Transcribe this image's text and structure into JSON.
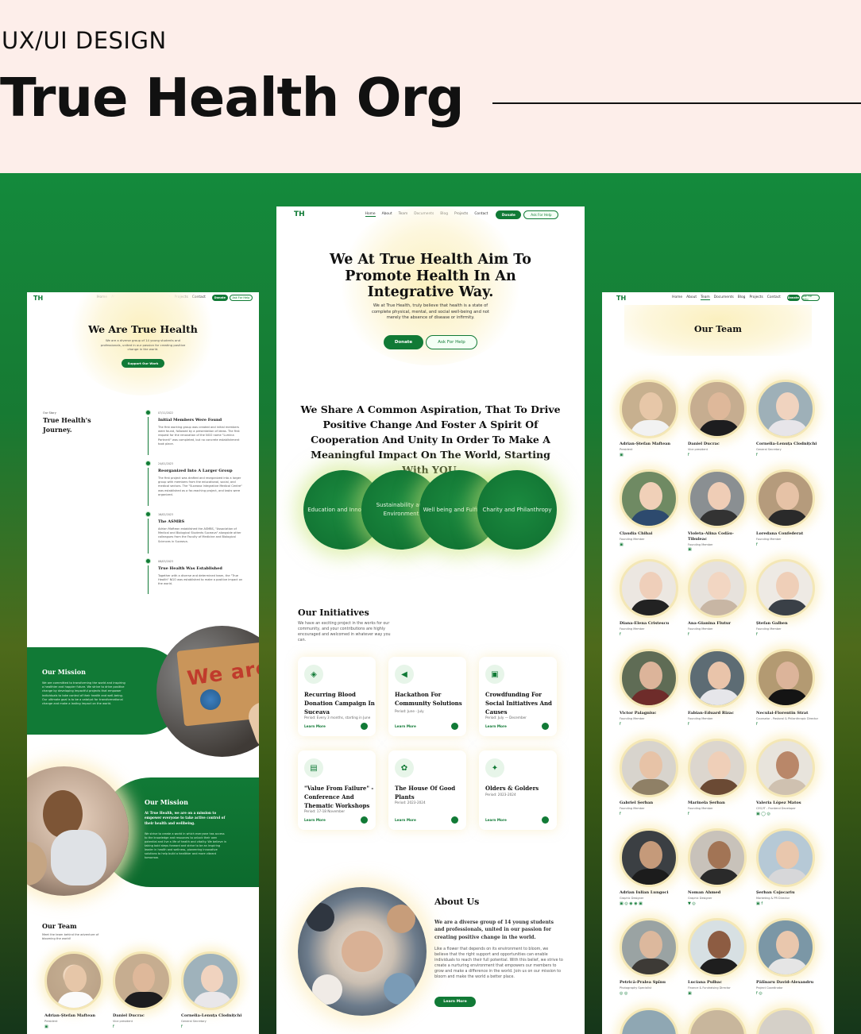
{
  "header": {
    "kicker": "UX/UI DESIGN",
    "title": "True Health Org"
  },
  "nav": {
    "logo": "TH",
    "links": [
      "Home",
      "About",
      "Team",
      "Documents",
      "Blog",
      "Projects",
      "Contact"
    ],
    "donate": "Donate",
    "help": "Ask For Help"
  },
  "about_page": {
    "hero_title": "We Are True Health",
    "hero_text": "We are a diverse group of 14 young students and professionals, united in our passion for creating positive change in the world.",
    "hero_button": "Support Our Work",
    "story_kicker": "Our Story",
    "story_title": "True Health's Journey.",
    "timeline": [
      {
        "date": "07/11/2022",
        "title": "Initial Members Were Found",
        "text": "The first working group was created and initial members were found, followed by a presentation of ideas. The first request for the renovation of the NGO name \"Lumina Partnerii\" was completed, but no concrete establishment took place."
      },
      {
        "date": "24/01/2023",
        "title": "Reorganized Into A Larger Group",
        "text": "The first project was drafted and reorganized into a larger group with members from the educational, social, and medical sectors. The \"Suceava Integrative Medical Centre\" was established as a far-reaching project, and tasks were organized."
      },
      {
        "date": "16/02/2023",
        "title": "The ASMBS",
        "text": "Adrian Maftean established the ASMBS, \"Association of Medical and Biological Students Suceava\" alongside other colleagues from the Faculty of Medicine and Biological Sciences in Suceava."
      },
      {
        "date": "08/03/2023",
        "title": "True Health Was Established",
        "text": "Together with a diverse and determined team, the \"True Health\" NGO was established to make a positive impact on the world."
      }
    ],
    "mission1_title": "Our Mission",
    "mission1_text": "We are committed to transforming the world and inspiring a healthier and happier future. We strive to drive positive change by developing impactful projects that empower individuals to take control of their health and well-being. Our ultimate goal is to be a catalyst for transformational change and make a lasting impact on the world.",
    "sign_text": "We are THE",
    "mission2_title": "Our Mission",
    "mission2_lead": "At True Health, we are on a mission to empower everyone to take active control of their health and wellbeing.",
    "mission2_text": "We strive to create a world in which everyone has access to the knowledge and resources to unlock their own potential and live a life of health and vitality. We believe in taking bold steps forward and strive to be an inspiring leader in health and wellness, pioneering innovative solutions to help build a healthier and more vibrant tomorrow.",
    "team_title": "Our Team",
    "team_text": "Meet the team behind the adventure of blooming the world!"
  },
  "home_page": {
    "hero_title": "We At True Health Aim To Promote Health In An Integrative Way.",
    "hero_text": "We at True Health, truly believe that health is a state of complete physical, mental, and social well-being and not merely the absence of disease or infirmity.",
    "donate": "Donate",
    "help": "Ask For Help",
    "aspiration": "We Share A Common Aspiration, That To Drive Positive Change And Foster A Spirit Of Cooperation And Unity In Order To Make A Meaningful Impact On The World, Starting With YOU.",
    "pillars": [
      "Education and Innovation",
      "Sustainability and Environment",
      "Well being and Fulfillment",
      "Charity and Philanthropy"
    ],
    "initiatives_title": "Our Initiatives",
    "initiatives_text": "We have an exciting project in the works for our community, and your contributions are highly encouraged and welcomed in whatever way you can.",
    "initiatives": [
      {
        "icon": "blood-drop-icon",
        "glyph": "◈",
        "title": "Recurring Blood Donation Campaign In Suceava",
        "period": "Period: Every 3 months, starting in June",
        "link": "Learn More"
      },
      {
        "icon": "megaphone-icon",
        "glyph": "◀",
        "title": "Hackathon For Community Solutions",
        "period": "Period: June - July",
        "link": "Learn More"
      },
      {
        "icon": "wallet-icon",
        "glyph": "▣",
        "title": "Crowdfunding For Social Initiatives And Causes",
        "period": "Period: July — December",
        "link": "Learn More"
      },
      {
        "icon": "presentation-icon",
        "glyph": "▤",
        "title": "\"Value From Failure\" - Conference And Thematic Workshops",
        "period": "Period: 17-18 November",
        "link": "Learn More"
      },
      {
        "icon": "plant-icon",
        "glyph": "✿",
        "title": "The House Of Good Plants",
        "period": "Period: 2023-2024",
        "link": "Learn More"
      },
      {
        "icon": "community-icon",
        "glyph": "✦",
        "title": "Olders & Golders",
        "period": "Period: 2023-2024",
        "link": "Learn More"
      }
    ],
    "about_title": "About Us",
    "about_lead": "We are a diverse group of 14 young students and professionals, united in our passion for creating positive change in the world.",
    "about_text": "Like a flower that depends on its environment to bloom, we believe that the right support and opportunities can enable individuals to reach their full potential. With this belief, we strive to create a nurturing environment that empowers our members to grow and make a difference in the world. Join us on our mission to bloom and make the world a better place.",
    "about_button": "Learn More"
  },
  "team_page": {
    "title": "Our Team",
    "members": [
      {
        "name": "Adrian-Ștefan Maftean",
        "role": "President",
        "social": "▣"
      },
      {
        "name": "Daniel Ducrac",
        "role": "Vice president",
        "social": "f"
      },
      {
        "name": "Cornelia-Lenuța Clodnițchi",
        "role": "General Secretary",
        "social": "f"
      },
      {
        "name": "Claudia Chihai",
        "role": "Founding Member",
        "social": "▣"
      },
      {
        "name": "Violeta-Alina Codău-Tibuleac",
        "role": "Founding Member",
        "social": "▣"
      },
      {
        "name": "Loredana Confederat",
        "role": "Founding Member",
        "social": "f"
      },
      {
        "name": "Diana-Elena Cristescu",
        "role": "Founding Member",
        "social": "f"
      },
      {
        "name": "Ana-Gianina Flutur",
        "role": "Founding Member",
        "social": "f"
      },
      {
        "name": "Ștefan Galben",
        "role": "Founding Member",
        "social": "f"
      },
      {
        "name": "Victor Palagniuc",
        "role": "Founding Member",
        "social": "f"
      },
      {
        "name": "Fabian-Eduard Rizac",
        "role": "Founding Member",
        "social": "f"
      },
      {
        "name": "Neculai-Florentin Strat",
        "role": "Counselor - Pastoral & Philanthropic Director",
        "social": "f"
      },
      {
        "name": "Gabriel Șerban",
        "role": "Founding Member",
        "social": "f"
      },
      {
        "name": "Marinela Șerban",
        "role": "Founding Member",
        "social": "f"
      },
      {
        "name": "Valeria López Matos",
        "role": "CEO/IT - Frontend Developer",
        "social": "▣ ◯ ◎"
      },
      {
        "name": "Adrian Iulian Lungoci",
        "role": "Graphic Designer",
        "social": "▣ ◎ ◉ ◉ ▣"
      },
      {
        "name": "Noman Ahmed",
        "role": "Graphic Designer",
        "social": "▼ ◎"
      },
      {
        "name": "Șerban Cojocariu",
        "role": "Marketing & PR Director",
        "social": "▣ f"
      },
      {
        "name": "Petrică-Pralea Spînu",
        "role": "Photography Specialist",
        "social": "◎ ◎"
      },
      {
        "name": "Luciana Pulbac",
        "role": "Finance & Fundraising Director",
        "social": "▣"
      },
      {
        "name": "Pălînaru David-Alexandru",
        "role": "Project Coordinator",
        "social": "f ◎"
      }
    ]
  },
  "colors": {
    "brand_green": "#117a36",
    "cream": "#fdeeea",
    "glow": "#fbf0bf"
  }
}
